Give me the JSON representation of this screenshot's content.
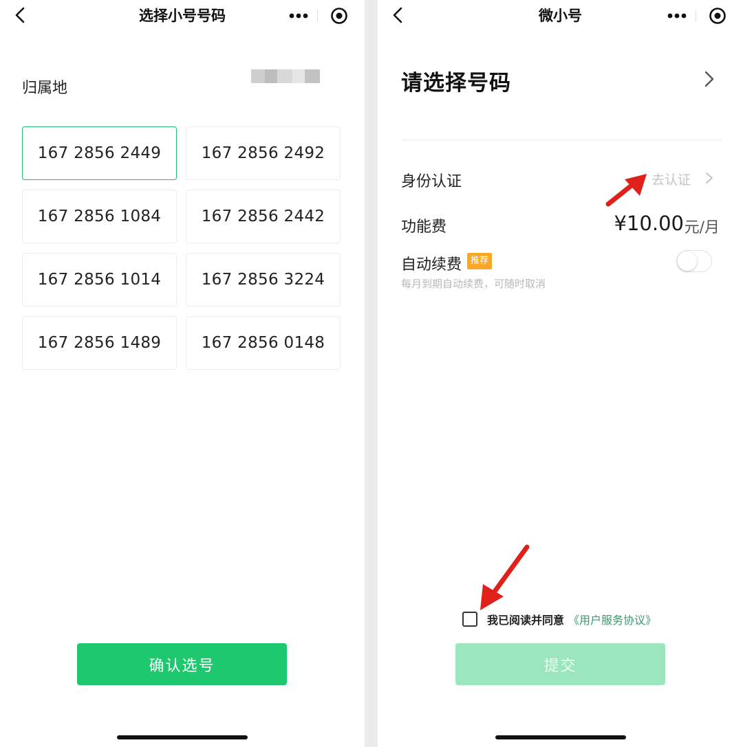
{
  "left": {
    "nav_title": "选择小号号码",
    "region_label": "归属地",
    "numbers": [
      "167 2856 2449",
      "167 2856 2492",
      "167 2856 1084",
      "167 2856 2442",
      "167 2856 1014",
      "167 2856 3224",
      "167 2856 1489",
      "167 2856 0148"
    ],
    "selected_index": 0,
    "confirm_label": "确认选号"
  },
  "right": {
    "nav_title": "微小号",
    "choose_title": "请选择号码",
    "identity_label": "身份认证",
    "identity_action": "去认证",
    "fee_label": "功能费",
    "fee_amount": "¥10.00",
    "fee_unit": "元/月",
    "auto_renew_label": "自动续费",
    "auto_renew_badge": "推荐",
    "auto_renew_desc": "每月到期自动续费，可随时取消",
    "auto_renew_on": false,
    "agree_text": "我已阅读并同意",
    "agree_link": "《用户服务协议》",
    "agree_checked": false,
    "submit_label": "提交"
  },
  "colors": {
    "accent_green": "#1ec86e",
    "selected_border": "#22b970",
    "submit_disabled": "#9ce6bd",
    "badge_orange": "#f9a825",
    "annotation_red": "#e0201b"
  },
  "icons": [
    "back-icon",
    "more-icon",
    "target-icon",
    "chevron-right-icon",
    "red-arrow-annotation"
  ]
}
